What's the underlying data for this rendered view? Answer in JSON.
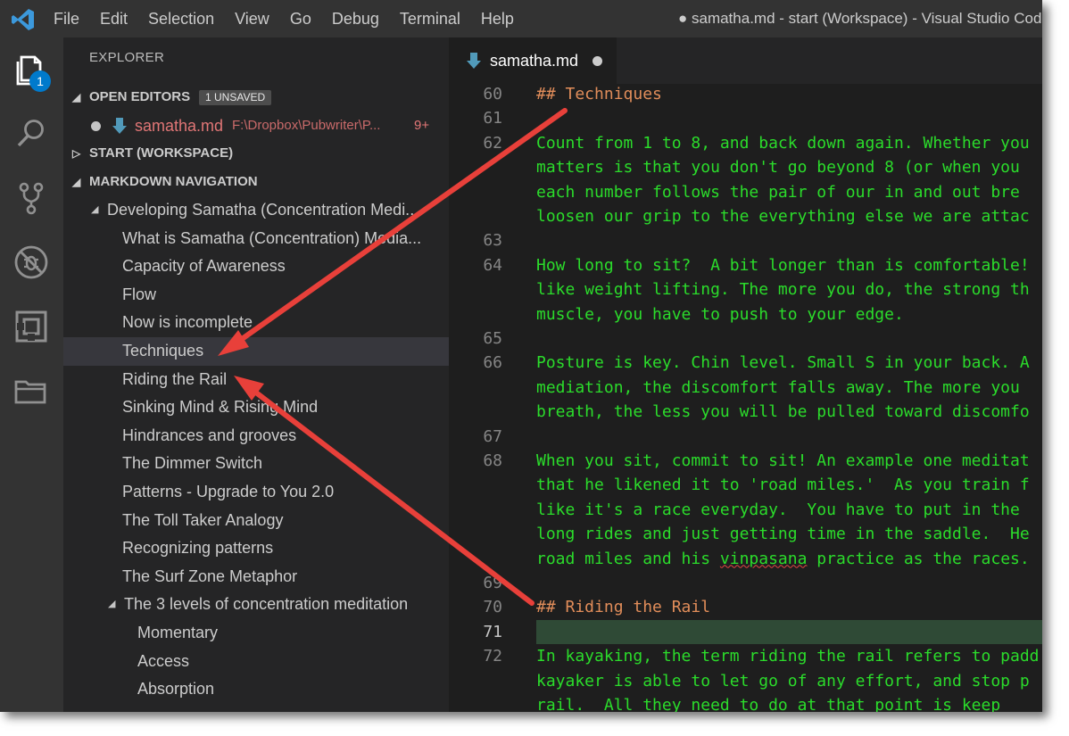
{
  "menu": [
    "File",
    "Edit",
    "Selection",
    "View",
    "Go",
    "Debug",
    "Terminal",
    "Help"
  ],
  "window_title": "● samatha.md - start (Workspace) - Visual Studio Code",
  "activity_bar": {
    "icons": [
      "files-icon",
      "search-icon",
      "source-control-icon",
      "debug-icon",
      "extensions-icon",
      "folder-icon"
    ],
    "explorer_badge": "1"
  },
  "sidebar": {
    "title": "EXPLORER",
    "open_editors": {
      "label": "OPEN EDITORS",
      "badge": "1 UNSAVED",
      "file": {
        "name": "samatha.md",
        "path": "F:\\Dropbox\\Pubwriter\\P...",
        "problems": "9+"
      }
    },
    "workspace": {
      "label": "START (WORKSPACE)"
    },
    "markdown_nav": {
      "label": "MARKDOWN NAVIGATION",
      "items": [
        {
          "label": "Developing Samatha (Concentration Medi...",
          "level": 1,
          "expanded": true
        },
        {
          "label": "What is Samatha (Concentration) Media...",
          "level": 2
        },
        {
          "label": "Capacity of Awareness",
          "level": 2
        },
        {
          "label": "Flow",
          "level": 2
        },
        {
          "label": "Now is incomplete",
          "level": 2
        },
        {
          "label": "Techniques",
          "level": 2,
          "selected": true
        },
        {
          "label": "Riding the Rail",
          "level": 2
        },
        {
          "label": "Sinking Mind & Rising Mind",
          "level": 2
        },
        {
          "label": "Hindrances and grooves",
          "level": 2
        },
        {
          "label": "The Dimmer Switch",
          "level": 2
        },
        {
          "label": "Patterns - Upgrade to You 2.0",
          "level": 2
        },
        {
          "label": "The Toll Taker Analogy",
          "level": 2
        },
        {
          "label": "Recognizing patterns",
          "level": 2
        },
        {
          "label": "The Surf Zone Metaphor",
          "level": 2
        },
        {
          "label": "The 3 levels of concentration meditation",
          "level": 2,
          "expanded": true
        },
        {
          "label": "Momentary",
          "level": 3
        },
        {
          "label": "Access",
          "level": 3
        },
        {
          "label": "Absorption",
          "level": 3
        }
      ]
    }
  },
  "editor": {
    "tab": {
      "label": "samatha.md"
    },
    "current_line": "71",
    "lines": [
      {
        "ln": "60",
        "text": "## Techniques",
        "kind": "heading"
      },
      {
        "ln": "61",
        "text": ""
      },
      {
        "ln": "62",
        "text": "Count from 1 to 8, and back down again. Whether you"
      },
      {
        "ln": "",
        "text": "matters is that you don't go beyond 8 (or when you"
      },
      {
        "ln": "",
        "text": "each number follows the pair of our in and out bre"
      },
      {
        "ln": "",
        "text": "loosen our grip to the everything else we are attac"
      },
      {
        "ln": "63",
        "text": ""
      },
      {
        "ln": "64",
        "text": "How long to sit?  A bit longer than is comfortable!"
      },
      {
        "ln": "",
        "text": "like weight lifting. The more you do, the strong th"
      },
      {
        "ln": "",
        "text": "muscle, you have to push to your edge."
      },
      {
        "ln": "65",
        "text": ""
      },
      {
        "ln": "66",
        "text": "Posture is key. Chin level. Small S in your back. A"
      },
      {
        "ln": "",
        "text": "mediation, the discomfort falls away. The more you"
      },
      {
        "ln": "",
        "text": "breath, the less you will be pulled toward discomfo"
      },
      {
        "ln": "67",
        "text": ""
      },
      {
        "ln": "68",
        "text": "When you sit, commit to sit! An example one meditat"
      },
      {
        "ln": "",
        "text": "that he likened it to 'road miles.'  As you train f"
      },
      {
        "ln": "",
        "text": "like it's a race everyday.  You have to put in the"
      },
      {
        "ln": "",
        "text": "long rides and just getting time in the saddle.  He"
      },
      {
        "ln": "",
        "text": "road miles and his ",
        "squiggle": "vinpasana",
        "after": " practice as the races."
      },
      {
        "ln": "69",
        "text": ""
      },
      {
        "ln": "70",
        "text": "## Riding the Rail",
        "kind": "heading"
      },
      {
        "ln": "71",
        "text": "",
        "current": true
      },
      {
        "ln": "72",
        "text": "In kayaking, the term riding the rail refers to padd"
      },
      {
        "ln": "",
        "text": "kayaker is able to let go of any effort, and stop p"
      },
      {
        "ln": "",
        "text": "rail.  All they need to do at that point is keep"
      }
    ]
  },
  "colors": {
    "activity_bar": "#333333",
    "sidebar": "#252526",
    "editor": "#1e1e1e",
    "code_text": "#2bdc2b",
    "heading_text": "#e18d5a",
    "badge": "#007acc",
    "annotation_arrow": "#e8403a"
  }
}
